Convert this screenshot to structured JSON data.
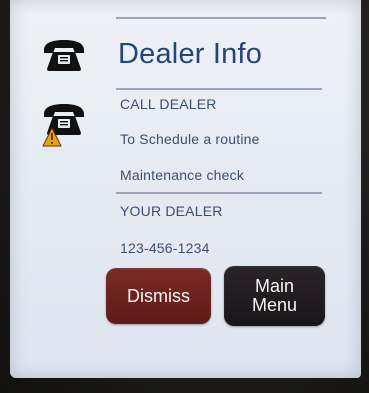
{
  "header": {
    "title": "Dealer Info"
  },
  "message": {
    "call_label": "CALL DEALER",
    "line_one": "To Schedule a routine",
    "line_two": "Maintenance check"
  },
  "dealer": {
    "label": "YOUR DEALER",
    "phone": "123-456-1234"
  },
  "buttons": {
    "dismiss_label": "Dismiss",
    "main_menu_line1": "Main",
    "main_menu_line2": "Menu"
  },
  "icons": {
    "dealer_phone": "telephone-icon",
    "alert_phone": "telephone-warning-icon"
  },
  "colors": {
    "screen_background": "#e6ebf3",
    "title": "#24457a",
    "text": "#3d4f6e",
    "dismiss_button": "#6e2320",
    "main_menu_button": "#221c20",
    "warning": "#e8a317"
  }
}
